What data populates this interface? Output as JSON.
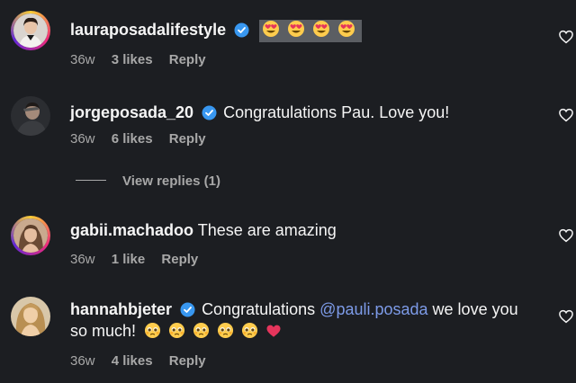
{
  "comments": [
    {
      "username": "lauraposadalifestyle",
      "verified": true,
      "text": "",
      "emoji": [
        "heart-eyes",
        "heart-eyes",
        "heart-eyes",
        "heart-eyes"
      ],
      "time": "36w",
      "likes": "3 likes",
      "reply": "Reply"
    },
    {
      "username": "jorgeposada_20",
      "verified": true,
      "text": "Congratulations Pau. Love you!",
      "time": "36w",
      "likes": "6 likes",
      "reply": "Reply",
      "view_replies": "View replies (1)"
    },
    {
      "username": "gabii.machadoo",
      "verified": false,
      "text": "These are amazing",
      "time": "36w",
      "likes": "1 like",
      "reply": "Reply"
    },
    {
      "username": "hannahbjeter",
      "verified": true,
      "text_before": "Congratulations",
      "mention": "@pauli.posada",
      "text_after": "we love you",
      "text_line2": "so much!",
      "emoji": [
        "pleading-face",
        "pleading-face",
        "pleading-face",
        "pleading-face",
        "pleading-face",
        "red-heart"
      ],
      "time": "36w",
      "likes": "4 likes",
      "reply": "Reply"
    }
  ],
  "colors": {
    "background": "#1c1e22",
    "text": "#f5f5f5",
    "secondary": "#a8a8a8",
    "mention": "#7d9be8",
    "verified": "#3897f0"
  }
}
